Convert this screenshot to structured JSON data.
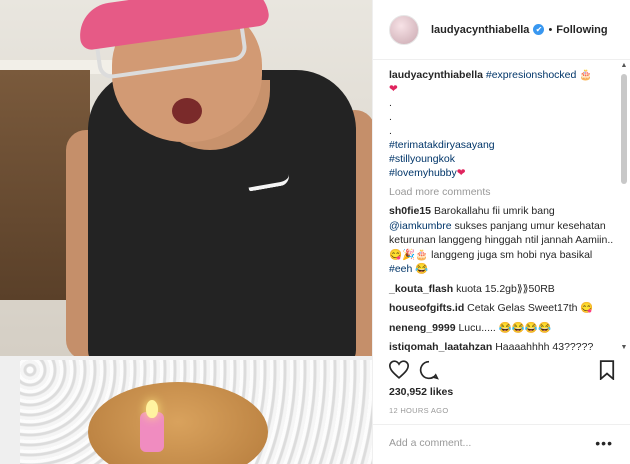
{
  "header": {
    "username": "laudyacynthiabella",
    "verified_mark": "✔",
    "separator": "•",
    "follow_status": "Following"
  },
  "caption": {
    "username": "laudyacynthiabella",
    "hashtag1": "#expresionshocked",
    "emoji1": "🎂",
    "heart": "❤",
    "dot": ".",
    "hashtag2": "#terimatakdiryasayang",
    "hashtag3": "#stillyoungkok",
    "hashtag4": "#lovemyhubby"
  },
  "load_more": "Load more comments",
  "comments": [
    {
      "user": "sh0fie15",
      "text_a": " Barokallahu fii umrik bang ",
      "mention": "@iamkumbre",
      "text_b": " sukses panjang umur kesehatan keturunan langgeng hinggah ntil jannah Aamiin.. 😋🎉🎂 langgeng juga sm hobi nya basikal ",
      "tag": "#eeh",
      "text_c": " 😂"
    },
    {
      "user": "_kouta_flash",
      "text": " kuota 15.2gb⟫⟫50RB"
    },
    {
      "user": "houseofgifts.id",
      "text": " Cetak Gelas Sweet17th 😋"
    },
    {
      "user": "neneng_9999",
      "text": " Lucu..... 😂😂😂😂"
    },
    {
      "user": "istiqomah_laatahzan",
      "text": " Haaaahhhh 43?????"
    }
  ],
  "actions": {
    "like_icon": "heart-outline-icon",
    "comment_icon": "comment-bubble-icon",
    "save_icon": "bookmark-icon"
  },
  "likes": "230,952 likes",
  "time": "12 HOURS AGO",
  "add_comment_placeholder": "Add a comment...",
  "more_options": "•••",
  "colors": {
    "link": "#003569",
    "verified": "#3897f0",
    "heart": "#e0245e",
    "muted": "#999999"
  }
}
